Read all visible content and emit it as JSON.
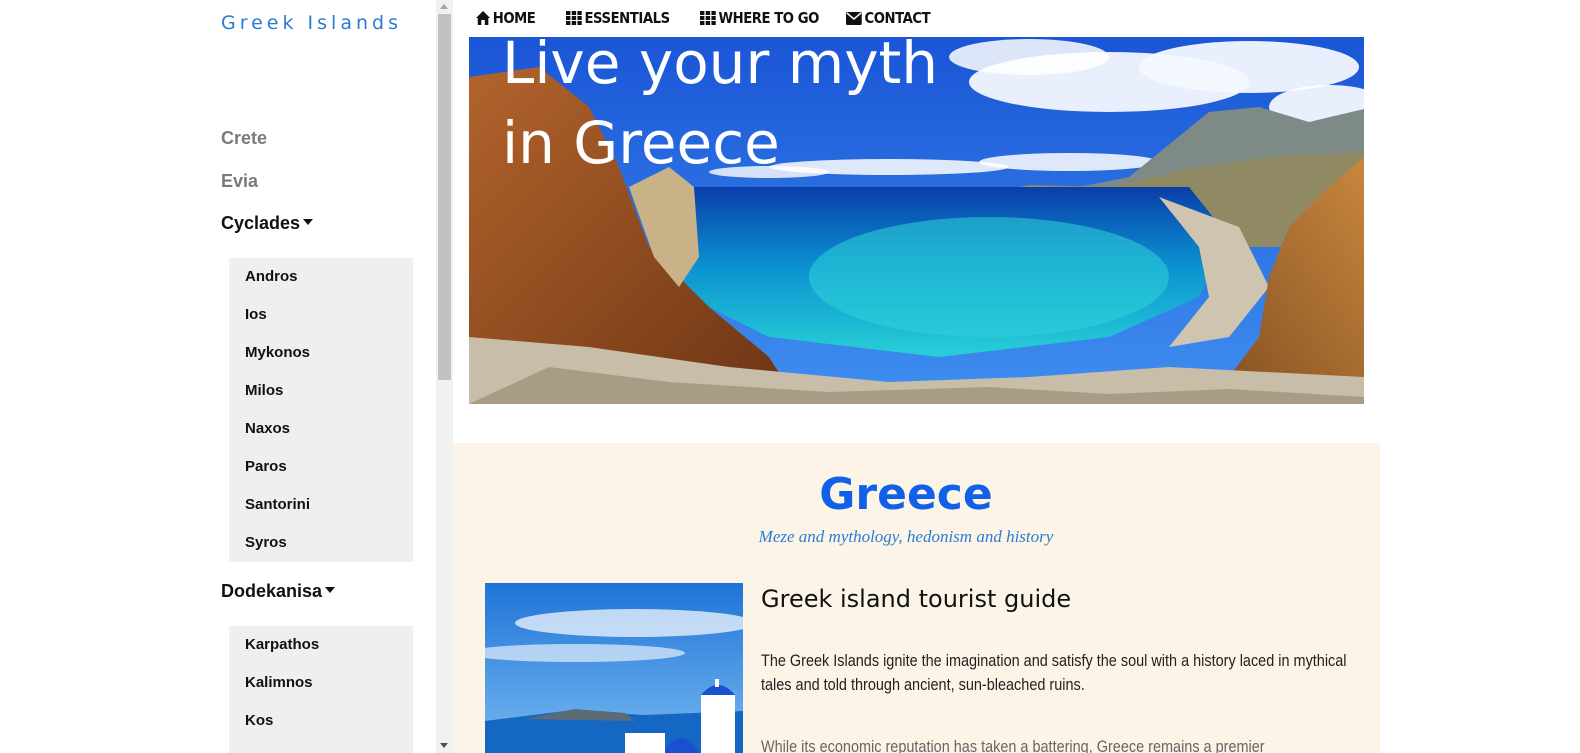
{
  "brand": "Greek Islands",
  "sidebar": {
    "links": [
      "Crete",
      "Evia"
    ],
    "groups": [
      {
        "label": "Cyclades",
        "items": [
          "Andros",
          "Ios",
          "Mykonos",
          "Milos",
          "Naxos",
          "Paros",
          "Santorini",
          "Syros"
        ]
      },
      {
        "label": "Dodekanisa",
        "items": [
          "Karpathos",
          "Kalimnos",
          "Kos"
        ]
      }
    ]
  },
  "nav": {
    "home": "HOME",
    "essentials": "ESSENTIALS",
    "where_to_go": "WHERE TO GO",
    "contact": "CONTACT"
  },
  "hero": {
    "line1": "Live your myth",
    "line2": "in Greece"
  },
  "main": {
    "title": "Greece",
    "tagline": "Meze and mythology, hedonism and history",
    "heading": "Greek island tourist guide",
    "paragraph1": "The Greek Islands ignite the imagination and satisfy the soul with a history laced in mythical tales and told through ancient, sun-bleached ruins.",
    "paragraph2": "While its economic reputation has taken a battering, Greece remains a premier"
  },
  "colors": {
    "brand": "#2a7bd6",
    "title": "#1160e8",
    "card_bg": "#fcf4e6",
    "submenu_bg": "#efefef"
  },
  "icons": {
    "home": "home-icon",
    "essentials": "grid-icon",
    "where_to_go": "grid-icon",
    "contact": "envelope-icon"
  }
}
